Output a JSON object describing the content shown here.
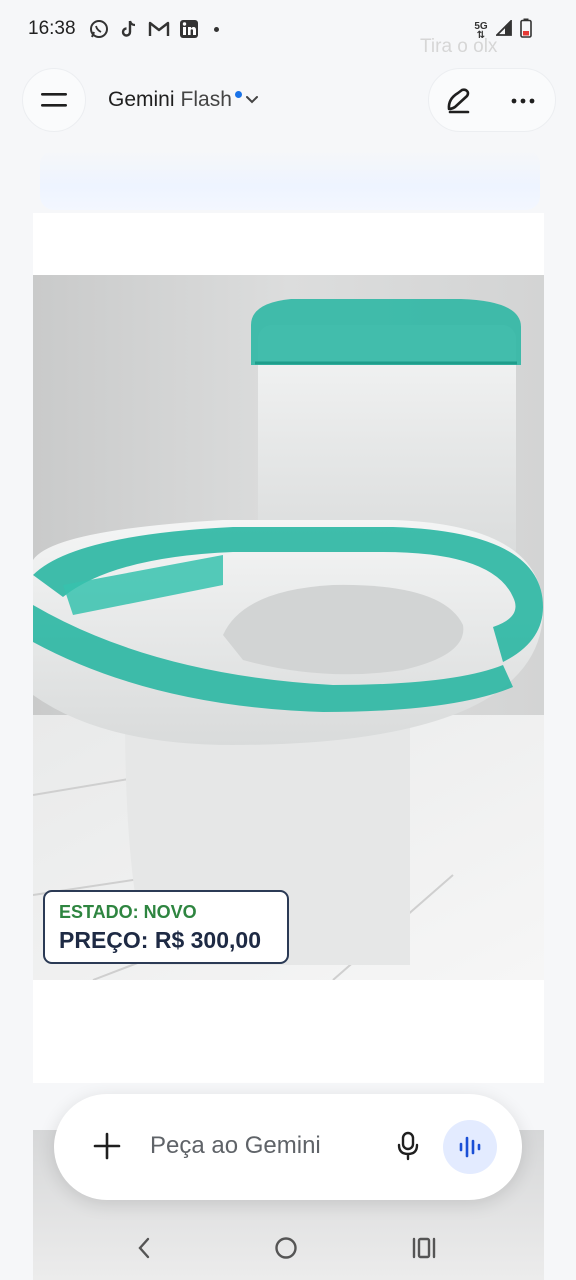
{
  "status_bar": {
    "time": "16:38",
    "apps": [
      "whatsapp-icon",
      "tiktok-icon",
      "gmail-icon",
      "linkedin-icon"
    ],
    "network_top": "5G",
    "network_bottom": "⇅"
  },
  "background_text": "Tira o olx",
  "header": {
    "model_name": "Gemini",
    "model_variant": "Flash",
    "accent_color": "#1a73e8"
  },
  "attachment": {
    "badge_state": "ESTADO: NOVO",
    "badge_price": "PREÇO: R$ 300,00",
    "state_color": "#2e8540"
  },
  "composer": {
    "placeholder": "Peça ao Gemini",
    "live_button_bg": "#e3ebff"
  },
  "nav": {
    "buttons": [
      "back-icon",
      "home-icon",
      "recents-icon"
    ]
  }
}
